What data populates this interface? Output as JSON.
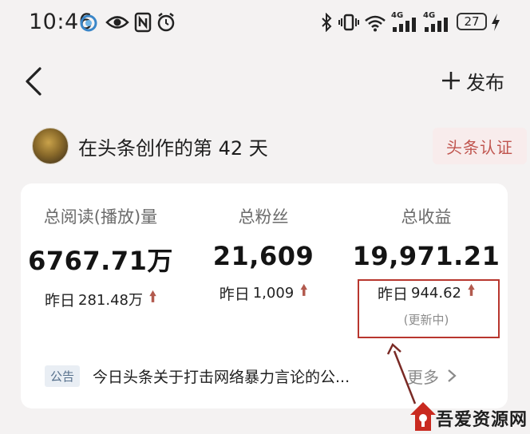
{
  "status_bar": {
    "time": "10:46",
    "battery": "27",
    "net1": "4G",
    "net2": "4G",
    "icons": [
      "qq-icon",
      "eye-icon",
      "nfc-icon",
      "alarm-icon",
      "bluetooth-icon",
      "vibrate-icon",
      "wifi-icon",
      "signal-icon",
      "signal-icon",
      "charging-icon"
    ]
  },
  "header": {
    "back_icon": "chevron-left-icon",
    "publish_label": "发布",
    "publish_icon": "plus-icon"
  },
  "creator": {
    "days_text": "在头条创作的第 42 天",
    "badge": "头条认证"
  },
  "stats": [
    {
      "label": "总阅读(播放)量",
      "value": "6767.71万",
      "yday_label": "昨日",
      "yday_value": "281.48万"
    },
    {
      "label": "总粉丝",
      "value": "21,609",
      "yday_label": "昨日",
      "yday_value": "1,009"
    },
    {
      "label": "总收益",
      "value": "19,971.21",
      "yday_label": "昨日",
      "yday_value": "944.62",
      "note": "(更新中)"
    }
  ],
  "notice": {
    "tag": "公告",
    "text": "今日头条关于打击网络暴力言论的公...",
    "more": "更多"
  },
  "watermark": {
    "text": "吾爱资源网"
  },
  "colors": {
    "accent_red": "#c0554f",
    "arrow_up": "#b25a4e",
    "highlight_box": "#b8362e",
    "notice_tag_bg": "#e9eef4"
  }
}
